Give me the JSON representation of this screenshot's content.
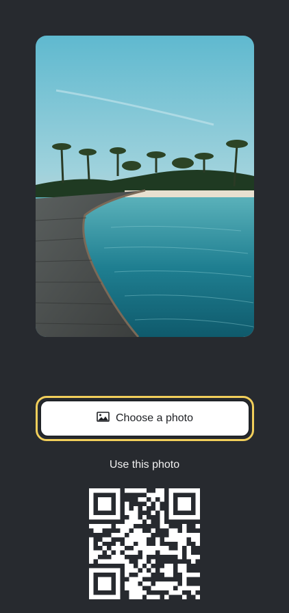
{
  "photo": {
    "alt": "Tropical beach with wooden boardwalk and palm trees"
  },
  "actions": {
    "choose_label": "Choose a photo",
    "use_label": "Use this photo"
  },
  "colors": {
    "background": "#272a2f",
    "focus_ring": "#f2cf5b",
    "button_bg": "#ffffff"
  },
  "icons": {
    "choose": "image-icon"
  }
}
